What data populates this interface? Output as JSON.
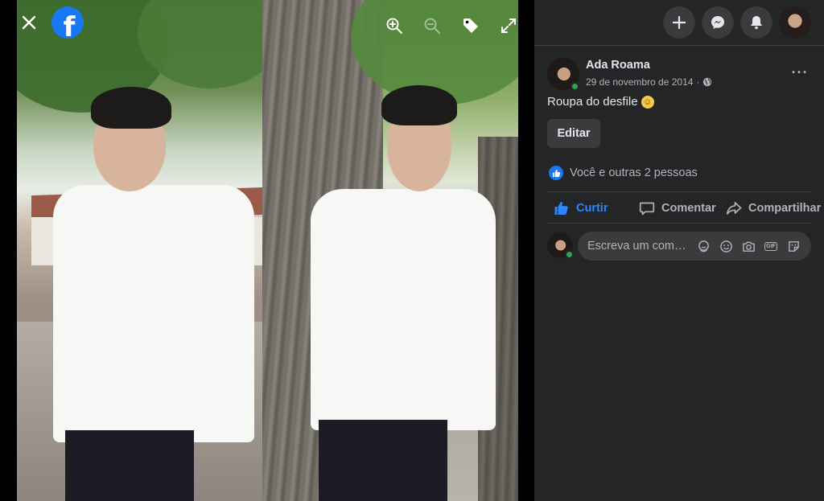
{
  "viewer": {
    "close_icon": "close-icon",
    "logo_icon": "facebook-logo",
    "logo_letter": "f",
    "tools": [
      "zoom-in-icon",
      "zoom-out-icon",
      "tag-icon",
      "fullscreen-icon"
    ]
  },
  "topbar": {
    "buttons": [
      "plus-icon",
      "messenger-icon",
      "notifications-bell-icon",
      "profile-avatar"
    ]
  },
  "post": {
    "author": "Ada Roama",
    "date": "29 de novembro de 2014",
    "separator": "·",
    "privacy_icon": "globe-icon",
    "more_label": "···",
    "text": "Roupa do desfile",
    "emoji": "☺",
    "edit_label": "Editar",
    "reactions_text": "Você e outras 2 pessoas"
  },
  "actions": {
    "like_label": "Curtir",
    "comment_label": "Comentar",
    "share_label": "Compartilhar"
  },
  "comment": {
    "placeholder": "Escreva um com…",
    "icons": [
      "avatar-sticker-icon",
      "emoji-icon",
      "camera-icon",
      "gif-icon",
      "sticker-icon"
    ],
    "gif_label": "GIF"
  },
  "colors": {
    "panel_bg": "#242526",
    "accent_blue": "#2d88ff",
    "facebook_blue": "#1877f2",
    "online_green": "#31a24c"
  }
}
